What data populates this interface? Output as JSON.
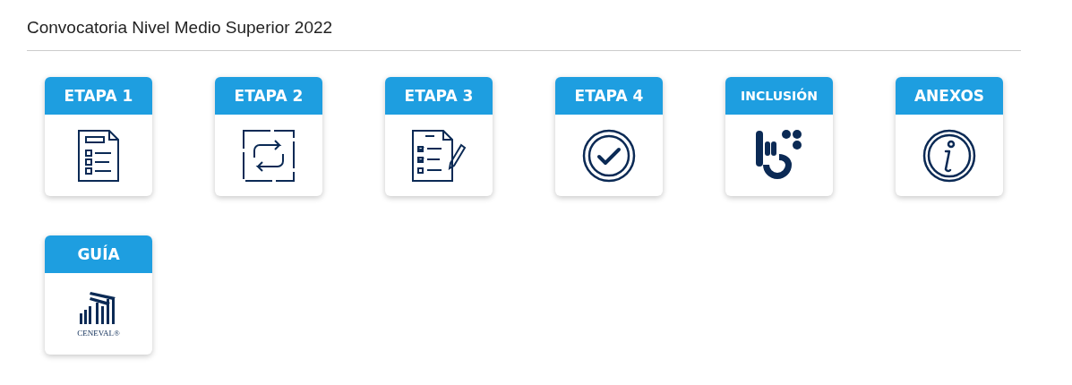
{
  "page_title": "Convocatoria Nivel Medio Superior 2022",
  "cards": [
    {
      "label": "ETAPA 1",
      "kind": "form"
    },
    {
      "label": "ETAPA 2",
      "kind": "exchange"
    },
    {
      "label": "ETAPA 3",
      "kind": "checklist"
    },
    {
      "label": "ETAPA 4",
      "kind": "check"
    },
    {
      "label": "INCLUSIÓN",
      "kind": "hand"
    },
    {
      "label": "ANEXOS",
      "kind": "info"
    },
    {
      "label": "GUÍA",
      "kind": "logo",
      "logo_text": "CENEVAL®"
    }
  ]
}
